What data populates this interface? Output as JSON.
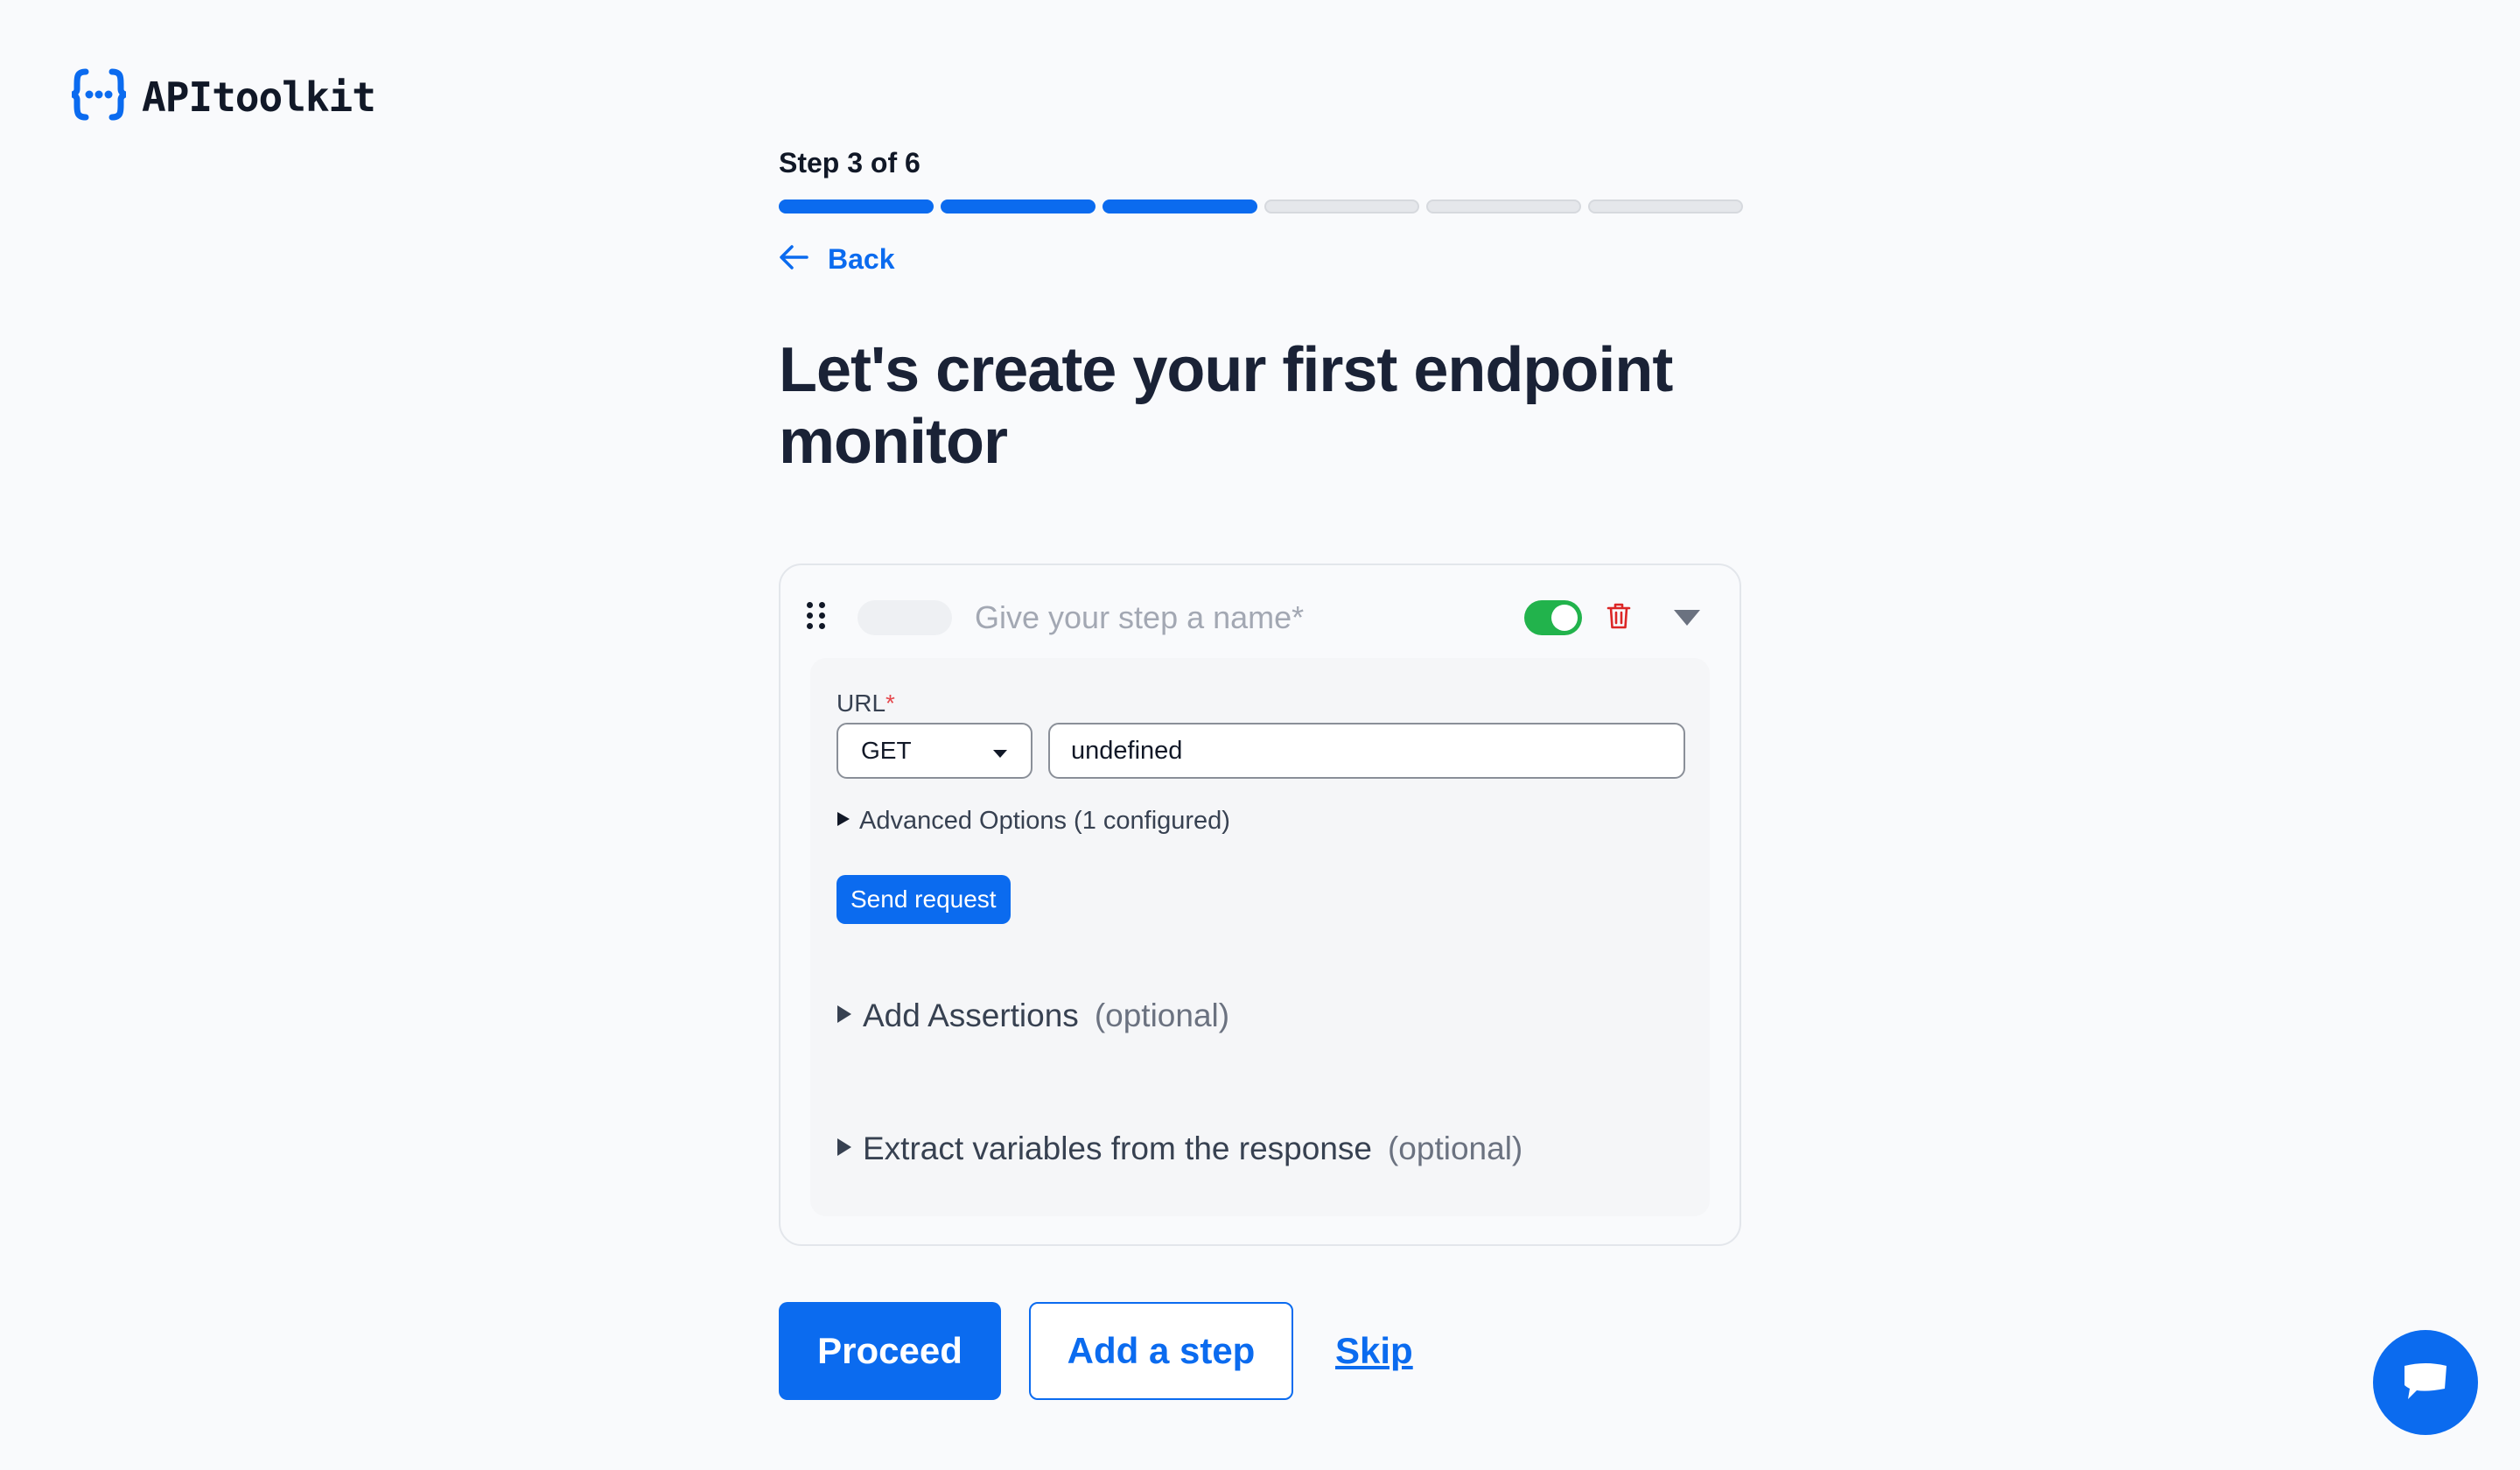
{
  "brand": {
    "name": "APItoolkit"
  },
  "onboarding": {
    "step_label": "Step 3 of 6",
    "current_step": 3,
    "total_steps": 6,
    "back_label": "Back",
    "heading": "Let's create your first endpoint monitor"
  },
  "step_card": {
    "name_placeholder": "Give your step a name*",
    "enabled": true,
    "url_label": "URL",
    "required_mark": "*",
    "method": "GET",
    "url_value": "undefined",
    "advanced_options_label": "Advanced Options (1 configured)",
    "send_request_label": "Send request",
    "assertions_title": "Add Assertions",
    "assertions_optional": "(optional)",
    "extract_title": "Extract variables from the response",
    "extract_optional": "(optional)"
  },
  "actions": {
    "proceed_label": "Proceed",
    "add_step_label": "Add a step",
    "skip_label": "Skip"
  },
  "colors": {
    "primary": "#0b6bef",
    "toggle_on": "#22b34c",
    "danger": "#e5484d"
  },
  "icons": [
    "logo-icon",
    "arrow-left-icon",
    "drag-handle-icon",
    "trash-icon",
    "chevron-down-icon",
    "triangle-right-icon",
    "chat-icon"
  ]
}
